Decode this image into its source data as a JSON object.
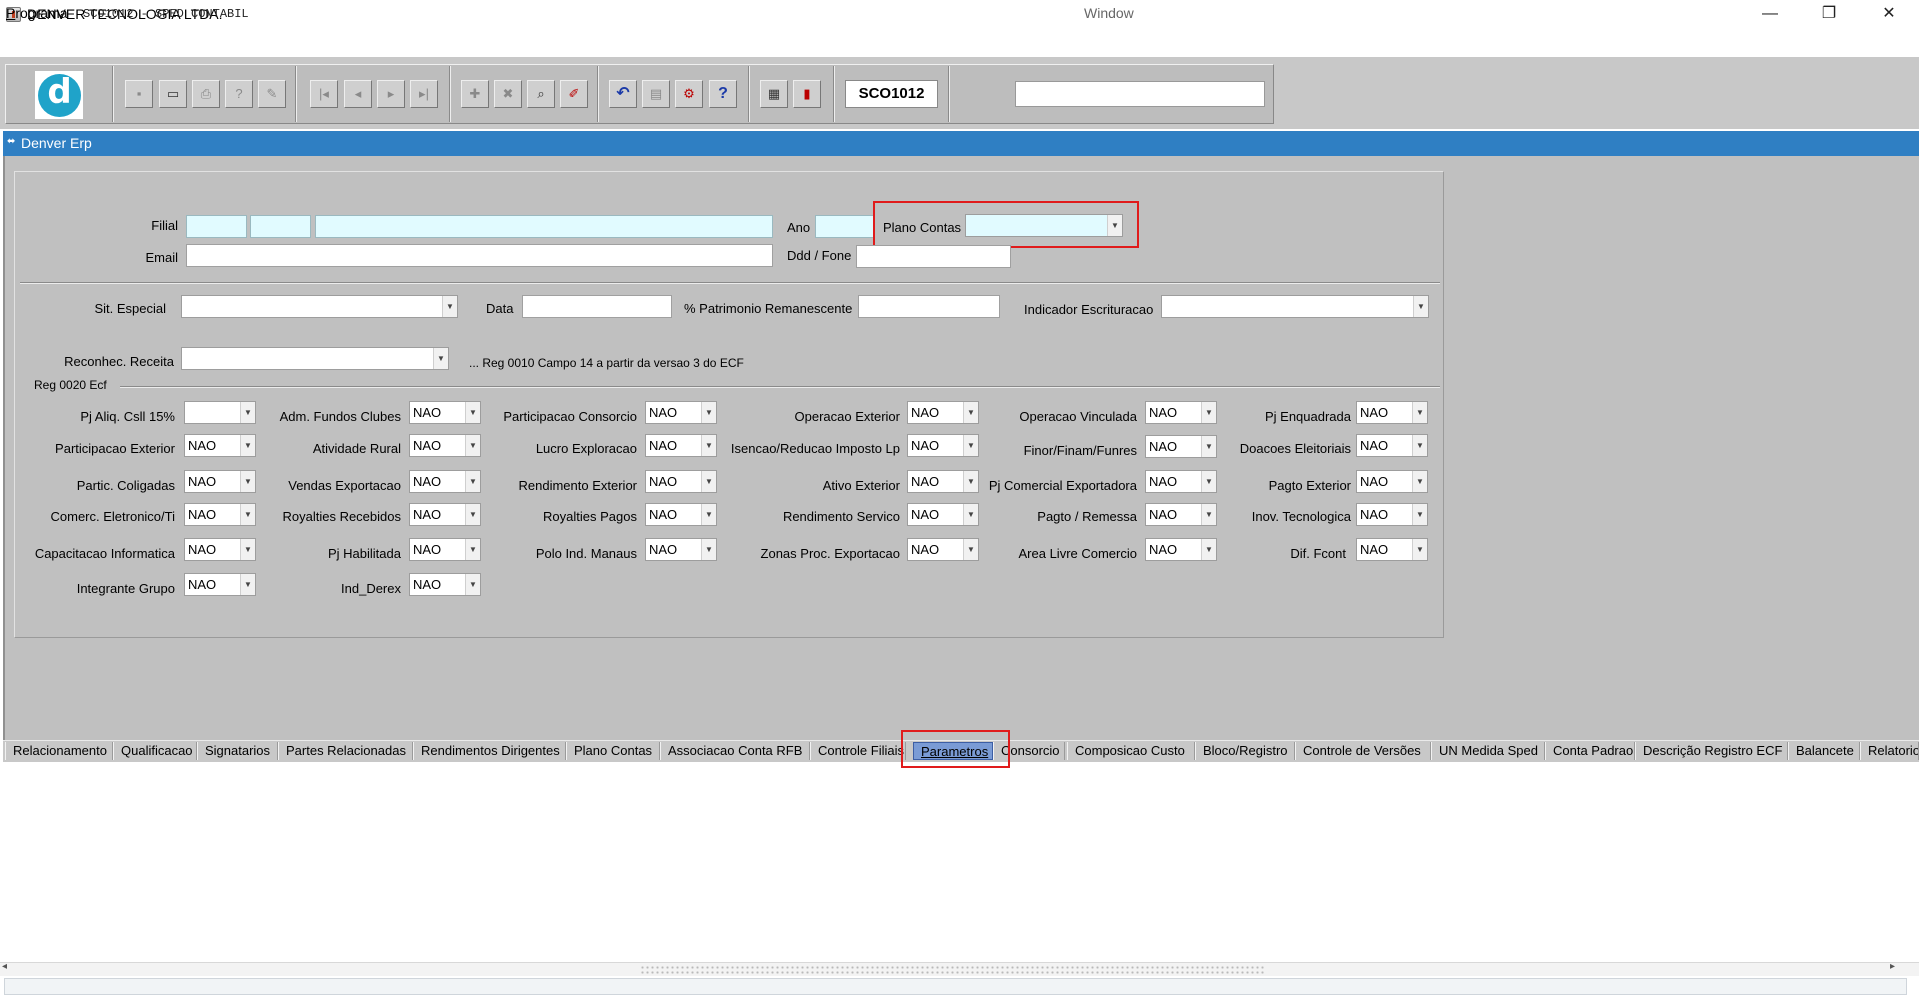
{
  "window": {
    "title": "DENVER TECNOLOGIA LTDA.",
    "minimize_glyph": "—",
    "restore_glyph": "❐",
    "close_glyph": "✕"
  },
  "menu": {
    "programa_first": "P",
    "programa_rest": "rograma",
    "caption": "SCO1012 - SPED CONTABIL",
    "window": "Window"
  },
  "toolbar": {
    "logo_letter": "d",
    "program_code": "SCO1012",
    "buttons": [
      {
        "icon": "save-icon",
        "glyph": "▪"
      },
      {
        "icon": "window-icon",
        "glyph": "▭"
      },
      {
        "icon": "print-icon",
        "glyph": "⎙"
      },
      {
        "icon": "query-help-icon",
        "glyph": "?"
      },
      {
        "icon": "edit-icon",
        "glyph": "✎"
      },
      {
        "icon": "first-record-icon",
        "glyph": "|◂"
      },
      {
        "icon": "previous-record-icon",
        "glyph": "◂"
      },
      {
        "icon": "next-record-icon",
        "glyph": "▸"
      },
      {
        "icon": "last-record-icon",
        "glyph": "▸|"
      },
      {
        "icon": "insert-record-icon",
        "glyph": "✚"
      },
      {
        "icon": "delete-record-icon",
        "glyph": "✖"
      },
      {
        "icon": "search-record-icon",
        "glyph": "⌕"
      },
      {
        "icon": "clear-record-icon",
        "glyph": "✐"
      },
      {
        "icon": "undo-icon",
        "glyph": "↶"
      },
      {
        "icon": "clipboard-icon",
        "glyph": "▤"
      },
      {
        "icon": "tools-icon",
        "glyph": "⚙"
      },
      {
        "icon": "help-icon",
        "glyph": "?"
      },
      {
        "icon": "menu-icon",
        "glyph": "▦"
      },
      {
        "icon": "exit-icon",
        "glyph": "▮"
      }
    ]
  },
  "inner_window": {
    "title": "Denver Erp",
    "icon_glyph": "⬌"
  },
  "header": {
    "filial_label": "Filial",
    "ano_label": "Ano",
    "plano_contas_label": "Plano Contas",
    "plano_contas_value": "",
    "email_label": "Email",
    "ddd_fone_label": "Ddd / Fone"
  },
  "general": {
    "sit_especial_label": "Sit. Especial",
    "data_label": "Data",
    "patrimonio_label": "% Patrimonio Remanescente",
    "indicador_label": "Indicador Escrituracao",
    "reconhec_label": "Reconhec. Receita",
    "reconhec_note": "... Reg 0010 Campo 14 a partir da versao 3 do ECF",
    "reg0020_label": "Reg 0020 Ecf"
  },
  "combo_arrow": "▼",
  "ecf": {
    "pj_aliq_csll": {
      "label": "Pj Aliq. Csll 15%",
      "value": ""
    },
    "adm_fundos_clubes": {
      "label": "Adm. Fundos Clubes",
      "value": "NAO"
    },
    "participacao_consorcio": {
      "label": "Participacao Consorcio",
      "value": "NAO"
    },
    "operacao_exterior": {
      "label": "Operacao Exterior",
      "value": "NAO"
    },
    "operacao_vinculada": {
      "label": "Operacao Vinculada",
      "value": "NAO"
    },
    "pj_enquadrada": {
      "label": "Pj Enquadrada",
      "value": "NAO"
    },
    "participacao_exterior": {
      "label": "Participacao Exterior",
      "value": "NAO"
    },
    "atividade_rural": {
      "label": "Atividade Rural",
      "value": "NAO"
    },
    "lucro_exploracao": {
      "label": "Lucro Exploracao",
      "value": "NAO"
    },
    "isencao_reducao": {
      "label": "Isencao/Reducao Imposto Lp",
      "value": "NAO"
    },
    "finor": {
      "label": "Finor/Finam/Funres",
      "value": "NAO"
    },
    "doacoes_eleitorais": {
      "label": "Doacoes Eleitoriais",
      "value": "NAO"
    },
    "partic_coligadas": {
      "label": "Partic. Coligadas",
      "value": "NAO"
    },
    "vendas_exportacao": {
      "label": "Vendas Exportacao",
      "value": "NAO"
    },
    "rendimento_exterior": {
      "label": "Rendimento Exterior",
      "value": "NAO"
    },
    "ativo_exterior": {
      "label": "Ativo Exterior",
      "value": "NAO"
    },
    "pj_comercial_exportadora": {
      "label": "Pj Comercial Exportadora",
      "value": "NAO"
    },
    "pagto_exterior": {
      "label": "Pagto Exterior",
      "value": "NAO"
    },
    "comerc_eletronico": {
      "label": "Comerc. Eletronico/Ti",
      "value": "NAO"
    },
    "royalties_recebidos": {
      "label": "Royalties Recebidos",
      "value": "NAO"
    },
    "royalties_pagos": {
      "label": "Royalties Pagos",
      "value": "NAO"
    },
    "rendimento_servico": {
      "label": "Rendimento Servico",
      "value": "NAO"
    },
    "pagto_remessa": {
      "label": "Pagto / Remessa",
      "value": "NAO"
    },
    "inov_tecnologica": {
      "label": "Inov. Tecnologica",
      "value": "NAO"
    },
    "capacitacao_informatica": {
      "label": "Capacitacao Informatica",
      "value": "NAO"
    },
    "pj_habilitada": {
      "label": "Pj Habilitada",
      "value": "NAO"
    },
    "polo_ind_manaus": {
      "label": "Polo Ind. Manaus",
      "value": "NAO"
    },
    "zonas_proc_exportacao": {
      "label": "Zonas Proc. Exportacao",
      "value": "NAO"
    },
    "area_livre_comercio": {
      "label": "Area Livre Comercio",
      "value": "NAO"
    },
    "dif_fcont": {
      "label": "Dif. Fcont",
      "value": "NAO"
    },
    "integrante_grupo": {
      "label": "Integrante Grupo",
      "value": "NAO"
    },
    "ind_derex": {
      "label": "Ind_Derex",
      "value": "NAO"
    }
  },
  "tabs": [
    "Relacionamento",
    "Qualificacao",
    "Signatarios",
    "Partes Relacionadas",
    "Rendimentos Dirigentes",
    "Plano Contas",
    "Associacao Conta RFB",
    "Controle Filiais",
    "Parametros",
    "Consorcio",
    "Composicao Custo",
    "Bloco/Registro",
    "Controle de Versões",
    "UN Medida Sped",
    "Conta Padrao",
    "Descrição Registro ECF",
    "Balancete",
    "Relatorio"
  ],
  "active_tab": "Parametros",
  "scroll": {
    "left_arrow": "◂",
    "right_arrow": "▸"
  },
  "highlight_color": "#e01b1b"
}
